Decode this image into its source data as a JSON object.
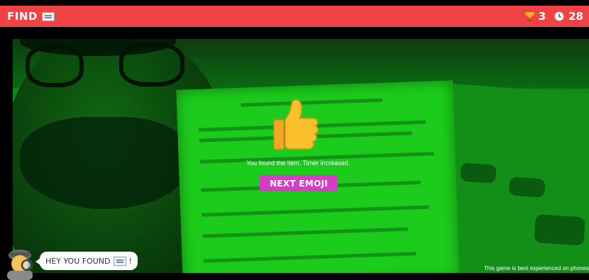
{
  "header": {
    "title": "FIND",
    "target_icon": "newspaper-icon",
    "trophy_count": "3",
    "timer_value": "28",
    "bar_color": "#ef4343"
  },
  "overlay": {
    "result_icon": "thumbs-up-icon",
    "message": "You found the item. Timer increased.",
    "next_label": "NEXT EMOJI",
    "button_color": "#d63cc6"
  },
  "mascot": {
    "icon": "detective-icon",
    "speech_prefix": "HEY YOU FOUND",
    "speech_icon": "newspaper-icon",
    "speech_suffix": "!"
  },
  "footer": {
    "note": "This game is best experienced on phones"
  }
}
